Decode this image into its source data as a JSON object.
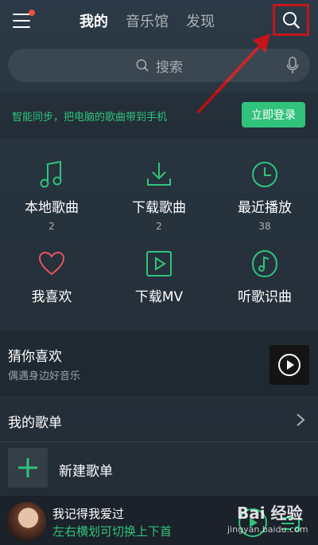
{
  "header": {
    "tabs": [
      {
        "label": "我的",
        "active": true
      },
      {
        "label": "音乐馆",
        "active": false
      },
      {
        "label": "发现",
        "active": false
      }
    ]
  },
  "search": {
    "placeholder": "搜索"
  },
  "sync": {
    "text": "智能同步，把电脑的歌曲带到手机",
    "login_label": "立即登录"
  },
  "grid": [
    {
      "icon": "music-note-icon",
      "label": "本地歌曲",
      "count": "2"
    },
    {
      "icon": "download-icon",
      "label": "下载歌曲",
      "count": "2"
    },
    {
      "icon": "clock-icon",
      "label": "最近播放",
      "count": "38"
    },
    {
      "icon": "heart-icon",
      "label": "我喜欢",
      "count": ""
    },
    {
      "icon": "video-play-icon",
      "label": "下载MV",
      "count": ""
    },
    {
      "icon": "music-recognize-icon",
      "label": "听歌识曲",
      "count": ""
    }
  ],
  "guess": {
    "title": "猜你喜欢",
    "subtitle": "偶遇身边好音乐"
  },
  "playlists": {
    "title": "我的歌单",
    "new_label": "新建歌单"
  },
  "player": {
    "song": "我记得我爱过",
    "hint": "左右横划可切换上下首"
  },
  "watermark": {
    "logo": "Bai 经验",
    "url": "jingyan.baidu.com"
  },
  "colors": {
    "accent": "#31c27c",
    "annotation": "#c4151c",
    "badge": "#e8543f"
  }
}
